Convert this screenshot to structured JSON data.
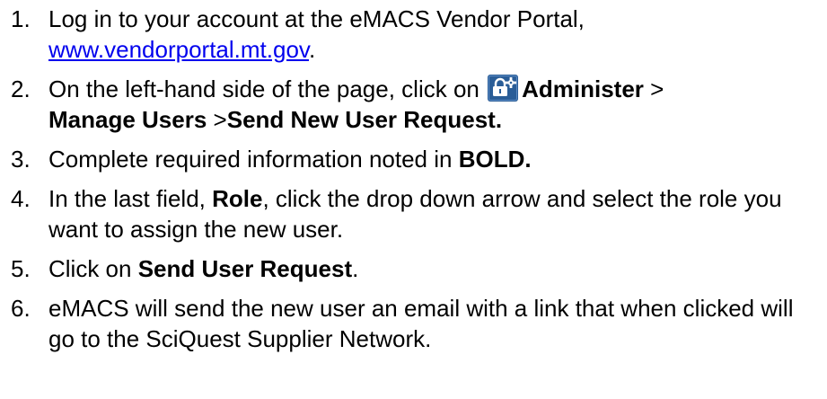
{
  "steps": [
    {
      "number": "1.",
      "text_before": "Log in to your account at the eMACS Vendor Portal,",
      "link_text": "www.vendorportal.mt.gov",
      "text_after": "."
    },
    {
      "number": "2.",
      "text_before": "On the left-hand side of the page, click on",
      "icon": "administer-icon",
      "bold_1": "Administer",
      "sep_1": " >",
      "bold_2": "Manage Users",
      "sep_2": " >",
      "bold_3": "Send New User Request."
    },
    {
      "number": "3.",
      "text_before": "Complete required information noted in ",
      "bold_1": "BOLD."
    },
    {
      "number": "4.",
      "text_before": "In the last field, ",
      "bold_1": "Role",
      "text_after": ", click the drop down arrow and select the role you want to assign the new user."
    },
    {
      "number": "5.",
      "text_before": "Click on ",
      "bold_1": "Send User Request",
      "text_after": "."
    },
    {
      "number": "6.",
      "text_before": "eMACS will send the new user an email with a link that when clicked will go to the SciQuest Supplier Network."
    }
  ],
  "colors": {
    "link": "#0000ee",
    "icon_bg": "#2a5d97",
    "text": "#000000"
  }
}
